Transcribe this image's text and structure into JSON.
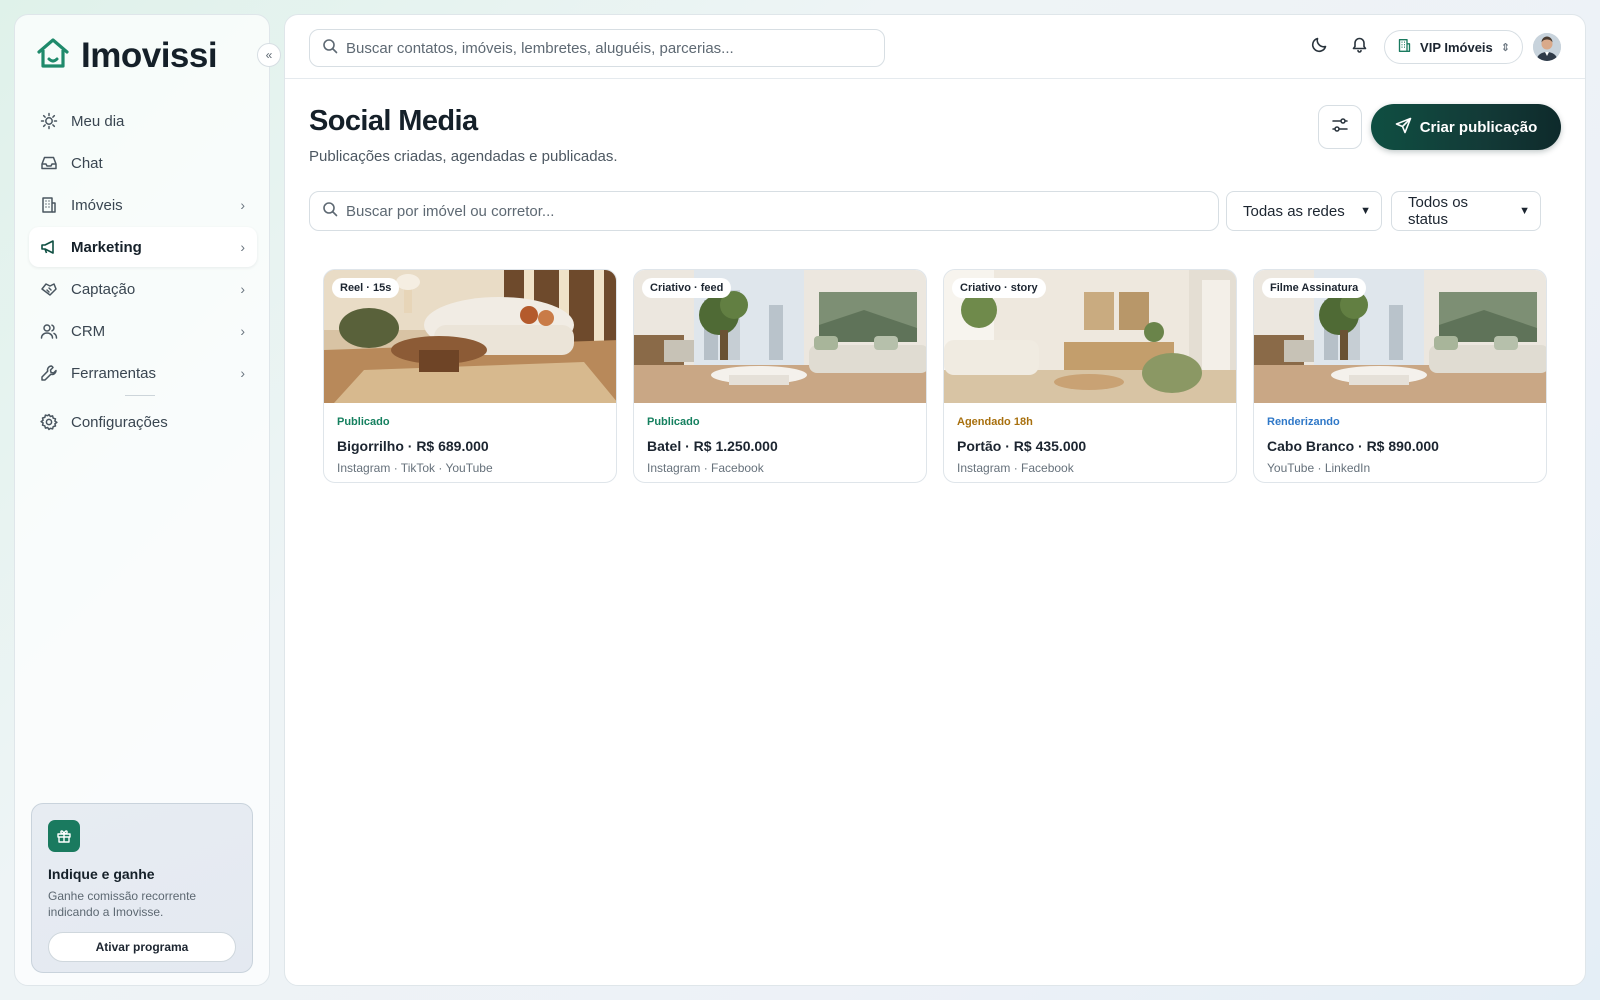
{
  "brand": {
    "name": "Imovissi"
  },
  "sidebar": {
    "collapse_label": "«",
    "items": [
      {
        "label": "Meu dia",
        "icon": "sun-icon",
        "has_chevron": false,
        "active": false
      },
      {
        "label": "Chat",
        "icon": "inbox-icon",
        "has_chevron": false,
        "active": false
      },
      {
        "label": "Imóveis",
        "icon": "building-icon",
        "has_chevron": true,
        "active": false
      },
      {
        "label": "Marketing",
        "icon": "megaphone-icon",
        "has_chevron": true,
        "active": true
      },
      {
        "label": "Captação",
        "icon": "handshake-icon",
        "has_chevron": true,
        "active": false
      },
      {
        "label": "CRM",
        "icon": "users-icon",
        "has_chevron": true,
        "active": false
      },
      {
        "label": "Ferramentas",
        "icon": "wrench-icon",
        "has_chevron": true,
        "active": false
      },
      {
        "label": "Configurações",
        "icon": "gear-icon",
        "has_chevron": false,
        "active": false
      }
    ],
    "promo": {
      "icon": "gift-icon",
      "title": "Indique e ganhe",
      "text": "Ganhe comissão recorrente indicando a Imovisse.",
      "button": "Ativar programa"
    }
  },
  "topbar": {
    "search_placeholder": "Buscar contatos, imóveis, lembretes, aluguéis, parcerias...",
    "theme_icon": "moon-icon",
    "notifications_icon": "bell-icon",
    "workspace": "VIP Imóveis"
  },
  "page": {
    "title": "Social Media",
    "subtitle": "Publicações criadas, agendadas e publicadas.",
    "create_button": "Criar publicação",
    "filter_search_placeholder": "Buscar por imóvel ou corretor...",
    "network_filter": "Todas as redes",
    "status_filter": "Todos os status"
  },
  "colors": {
    "accent": "#0f4f42",
    "status_published": "#15805f",
    "status_scheduled": "#a8700e",
    "status_rendering": "#2f78c8"
  },
  "posts": [
    {
      "badge": "Reel · 15s",
      "status": "Publicado",
      "status_color": "#15805f",
      "title": "Bigorrilho · R$ 689.000",
      "networks": "Instagram · TikTok · YouTube",
      "scene": "warm"
    },
    {
      "badge": "Criativo · feed",
      "status": "Publicado",
      "status_color": "#15805f",
      "title": "Batel · R$ 1.250.000",
      "networks": "Instagram · Facebook",
      "scene": "bright"
    },
    {
      "badge": "Criativo · story",
      "status": "Agendado 18h",
      "status_color": "#a8700e",
      "title": "Portão · R$ 435.000",
      "networks": "Instagram · Facebook",
      "scene": "beige"
    },
    {
      "badge": "Filme Assinatura",
      "status": "Renderizando",
      "status_color": "#2f78c8",
      "title": "Cabo Branco · R$ 890.000",
      "networks": "YouTube · LinkedIn",
      "scene": "bright"
    }
  ]
}
